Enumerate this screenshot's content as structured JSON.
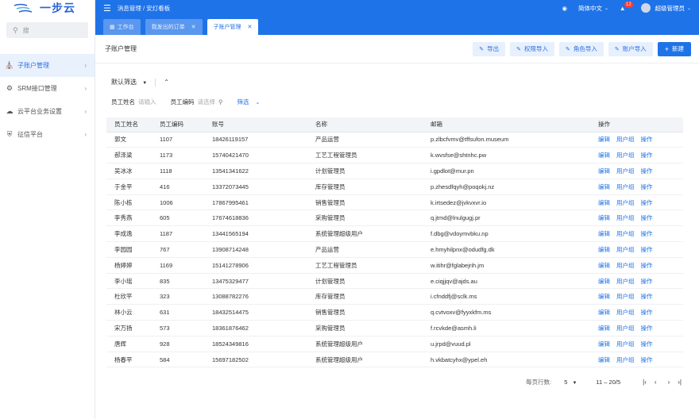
{
  "app": {
    "logo_text": "一步云"
  },
  "sidebar": {
    "search_placeholder": "搜",
    "items": [
      {
        "label": "子账户管理",
        "active": true
      },
      {
        "label": "SRM接口管理",
        "active": false
      },
      {
        "label": "云平台业务设置",
        "active": false
      },
      {
        "label": "征信平台",
        "active": false
      }
    ]
  },
  "topbar": {
    "breadcrumb": "消息管理 / 安灯看板",
    "language": "简体中文",
    "notification_count": "12",
    "user": "超级管理员"
  },
  "tabs": [
    {
      "label": "工作台",
      "closable": false,
      "active": false
    },
    {
      "label": "我发出的订单",
      "closable": true,
      "active": false
    },
    {
      "label": "子账户管理",
      "closable": true,
      "active": true
    }
  ],
  "page": {
    "title": "子账户管理",
    "actions": [
      "导出",
      "权限导入",
      "角色导入",
      "账户导入"
    ],
    "new_label": "新建"
  },
  "filter": {
    "default_label": "默认筛选",
    "fields": [
      {
        "label": "员工姓名",
        "placeholder": "请输入"
      },
      {
        "label": "员工编码",
        "placeholder": "请选择"
      }
    ],
    "filter_link": "筛选"
  },
  "table": {
    "columns": [
      "员工姓名",
      "员工编码",
      "账号",
      "名称",
      "邮箱",
      "操作"
    ],
    "op_labels": [
      "编辑",
      "用户组",
      "操作"
    ],
    "rows": [
      [
        "郭文",
        "1107",
        "18426119157",
        "产品运营",
        "p.zlbcfvmv@tffsufon.museum"
      ],
      [
        "郝泽梁",
        "1173",
        "15740421470",
        "工艺工程管理员",
        "k.wvsfse@shtnhc.pw"
      ],
      [
        "吴冰冰",
        "1118",
        "13541341622",
        "计划管理员",
        "i.gpdlot@mur.pn"
      ],
      [
        "于金平",
        "416",
        "13372073445",
        "库存管理员",
        "p.zhesdfqyh@poqokj.nz"
      ],
      [
        "陈小栋",
        "1006",
        "17867995461",
        "销售管理员",
        "k.irtsedez@jvkvxvr.io"
      ],
      [
        "李秀燕",
        "605",
        "17674618836",
        "采购管理员",
        "q.jtmd@lnulgugj.pr"
      ],
      [
        "李成逸",
        "1187",
        "13441565194",
        "系统管理超级用户",
        "f.dbg@vdoymvbku.np"
      ],
      [
        "李园园",
        "767",
        "13908714248",
        "产品运营",
        "e.hmyhilpnx@odudfg.dk"
      ],
      [
        "杨婷婷",
        "1169",
        "15141278906",
        "工艺工程管理员",
        "w.itihr@fglabejrih.jm"
      ],
      [
        "李小瑶",
        "835",
        "13475329477",
        "计划管理员",
        "e.ciqjjqv@ajds.au"
      ],
      [
        "杜欣平",
        "323",
        "13088782276",
        "库存管理员",
        "i.cfnddfj@sclk.ms"
      ],
      [
        "林小云",
        "631",
        "18432514475",
        "销售管理员",
        "q.cvtvoxv@fyyxkfm.ms"
      ],
      [
        "宋万扬",
        "573",
        "18361876462",
        "采购管理员",
        "f.rcvkde@asmh.li"
      ],
      [
        "唐辉",
        "928",
        "18524349816",
        "系统管理超级用户",
        "u.jrpd@vuud.pl"
      ],
      [
        "杨春平",
        "584",
        "15697182502",
        "系统管理超级用户",
        "h.vkbatcyhx@ypel.eh"
      ]
    ]
  },
  "pagination": {
    "page_size_label": "每页行数:",
    "page_size": "5",
    "range": "11 – 20/5"
  },
  "colors": {
    "primary": "#1f73e8",
    "sidebar_active_bg": "#e9f1fd"
  }
}
